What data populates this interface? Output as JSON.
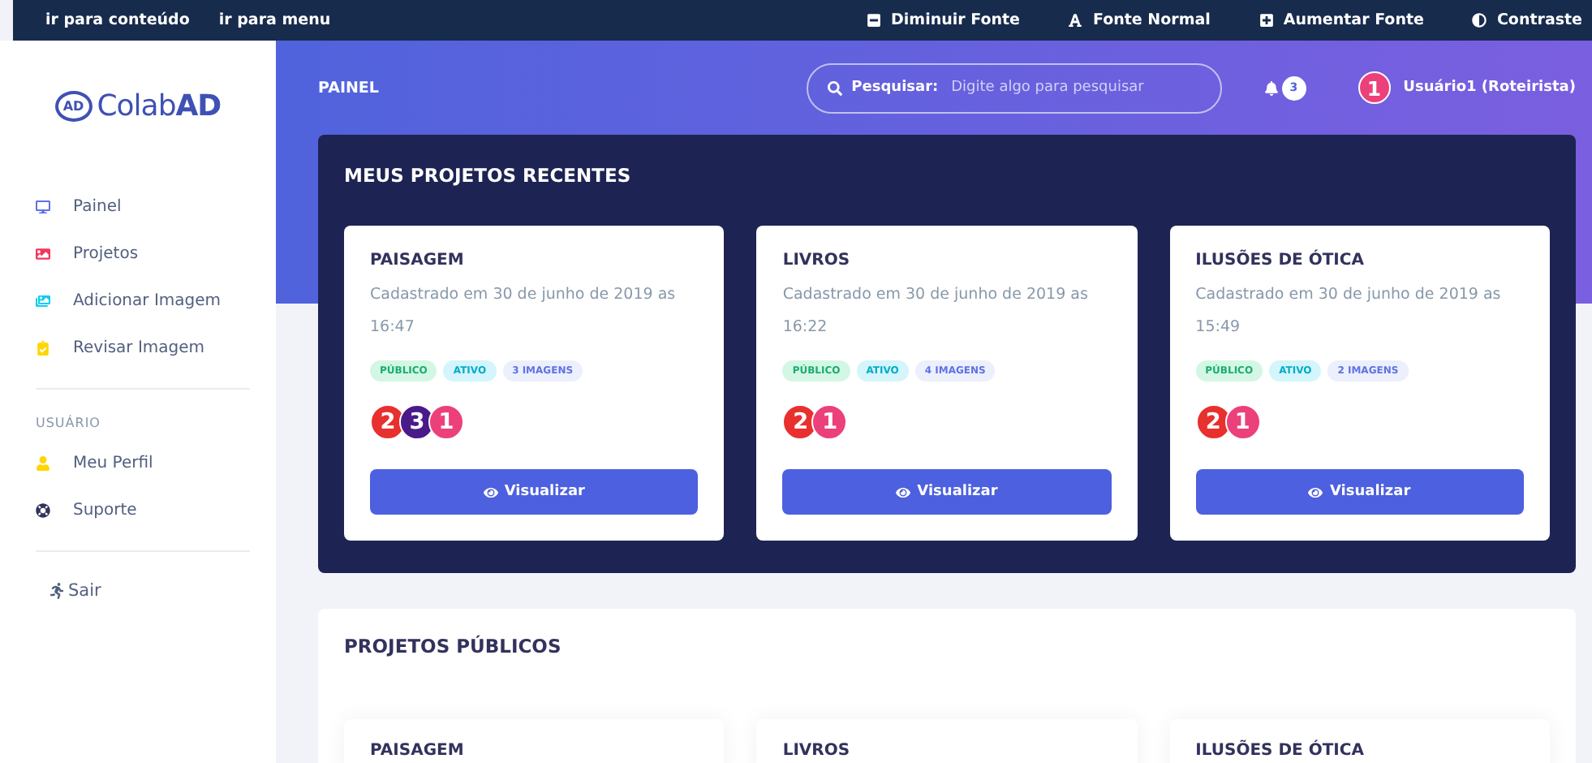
{
  "topbar": {
    "skip_links": [
      "ir para conteúdo",
      "ir para menu"
    ],
    "tools": [
      {
        "kind": "minus",
        "label": "Diminuir Fonte"
      },
      {
        "kind": "font",
        "label": "Fonte Normal"
      },
      {
        "kind": "plus",
        "label": "Aumentar Fonte"
      },
      {
        "kind": "contrast",
        "label": "Contraste"
      }
    ]
  },
  "sidebar": {
    "logo": {
      "badge": "AD",
      "prefix": "Colab",
      "suffix": "AD"
    },
    "items": [
      {
        "kind": "monitor",
        "label": "Painel",
        "color": "#5e72e4"
      },
      {
        "kind": "image",
        "label": "Projetos",
        "color": "#f5365c"
      },
      {
        "kind": "gallery",
        "label": "Adicionar Imagem",
        "color": "#11cdef"
      },
      {
        "kind": "clipboard",
        "label": "Revisar Imagem",
        "color": "#ffd600"
      }
    ],
    "section_title": "USUÁRIO",
    "user_items": [
      {
        "kind": "user",
        "label": "Meu Perfil",
        "color": "#ffd600"
      },
      {
        "kind": "support",
        "label": "Suporte",
        "color": "#32325d"
      }
    ],
    "logout": "Sair"
  },
  "header": {
    "title": "PAINEL",
    "search": {
      "label": "Pesquisar:",
      "placeholder": "Digite algo para pesquisar"
    },
    "notifications": "3",
    "user": {
      "avatar": "1",
      "name": "Usuário1 (Roteirista)"
    }
  },
  "recent": {
    "title": "MEUS PROJETOS RECENTES",
    "projects": [
      {
        "title": "PAISAGEM",
        "date": "Cadastrado em 30 de junho de 2019 as 16:47",
        "tags": [
          {
            "kind": "success",
            "label": "PÚBLICO"
          },
          {
            "kind": "info",
            "label": "ATIVO"
          },
          {
            "kind": "primary",
            "label": "3 IMAGENS"
          }
        ],
        "members": [
          {
            "label": "2",
            "color": "#e8302e"
          },
          {
            "label": "3",
            "color": "#4a1a8a"
          },
          {
            "label": "1",
            "color": "#ec407a"
          }
        ],
        "button": "Visualizar"
      },
      {
        "title": "LIVROS",
        "date": "Cadastrado em 30 de junho de 2019 as 16:22",
        "tags": [
          {
            "kind": "success",
            "label": "PÚBLICO"
          },
          {
            "kind": "info",
            "label": "ATIVO"
          },
          {
            "kind": "primary",
            "label": "4 IMAGENS"
          }
        ],
        "members": [
          {
            "label": "2",
            "color": "#e8302e"
          },
          {
            "label": "1",
            "color": "#ec407a"
          }
        ],
        "button": "Visualizar"
      },
      {
        "title": "ILUSÕES DE ÓTICA",
        "date": "Cadastrado em 30 de junho de 2019 as 15:49",
        "tags": [
          {
            "kind": "success",
            "label": "PÚBLICO"
          },
          {
            "kind": "info",
            "label": "ATIVO"
          },
          {
            "kind": "primary",
            "label": "2 IMAGENS"
          }
        ],
        "members": [
          {
            "label": "2",
            "color": "#e8302e"
          },
          {
            "label": "1",
            "color": "#ec407a"
          }
        ],
        "button": "Visualizar"
      }
    ]
  },
  "public": {
    "title": "PROJETOS PÚBLICOS",
    "projects": [
      "PAISAGEM",
      "LIVROS",
      "ILUSÕES DE ÓTICA"
    ]
  }
}
